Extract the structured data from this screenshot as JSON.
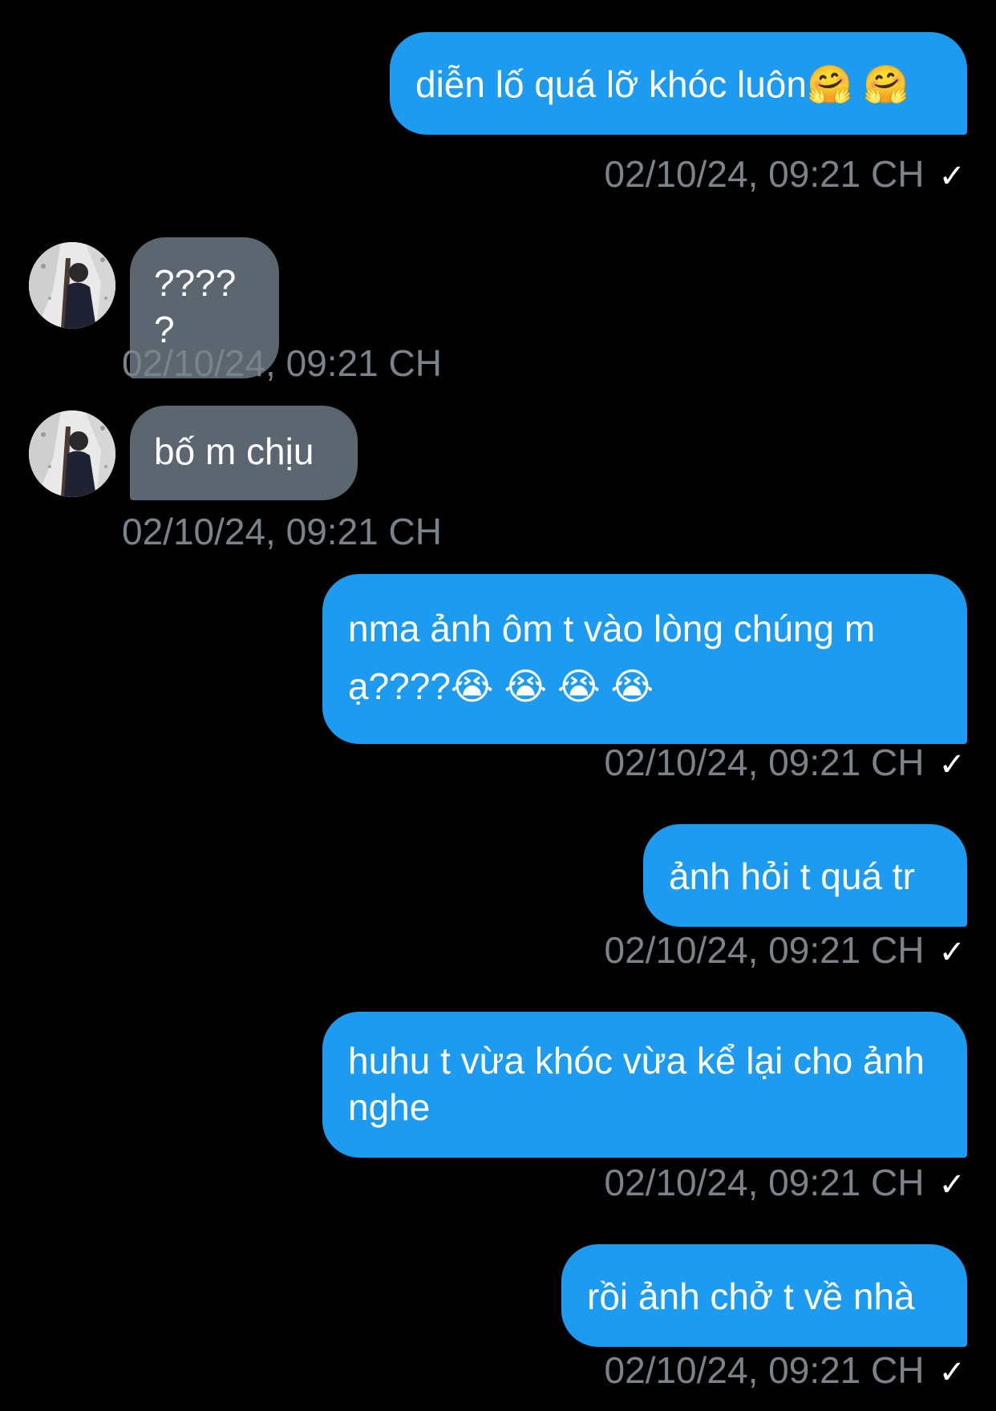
{
  "conversation": {
    "messages": [
      {
        "direction": "out",
        "text": "diễn lố quá lỡ khóc luôn🤗 🤗",
        "time": "02/10/24, 09:21 CH",
        "status": "sent"
      },
      {
        "direction": "in",
        "text": "?????",
        "time": "02/10/24, 09:21 CH"
      },
      {
        "direction": "in",
        "text": "bố m chịu",
        "time": "02/10/24, 09:21 CH"
      },
      {
        "direction": "out",
        "text": "nma ảnh ôm t vào lòng chúng m ạ????😭 😭 😭 😭",
        "time": "02/10/24, 09:21 CH",
        "status": "sent"
      },
      {
        "direction": "out",
        "text": "ảnh hỏi t quá tr",
        "time": "02/10/24, 09:21 CH",
        "status": "sent"
      },
      {
        "direction": "out",
        "text": "huhu t vừa khóc vừa kể lại cho ảnh nghe",
        "time": "02/10/24, 09:21 CH",
        "status": "sent"
      },
      {
        "direction": "out",
        "text": "rồi ảnh chở t về nhà",
        "time": "02/10/24, 09:21 CH",
        "status": "sent"
      }
    ],
    "status_icon": "✓",
    "avatar_icon": "contact-avatar"
  },
  "colors": {
    "background": "#000000",
    "outgoing_bubble": "#1d9bf0",
    "incoming_bubble": "#5b6670",
    "timestamp": "#7a828a",
    "message_text": "#ffffff"
  }
}
